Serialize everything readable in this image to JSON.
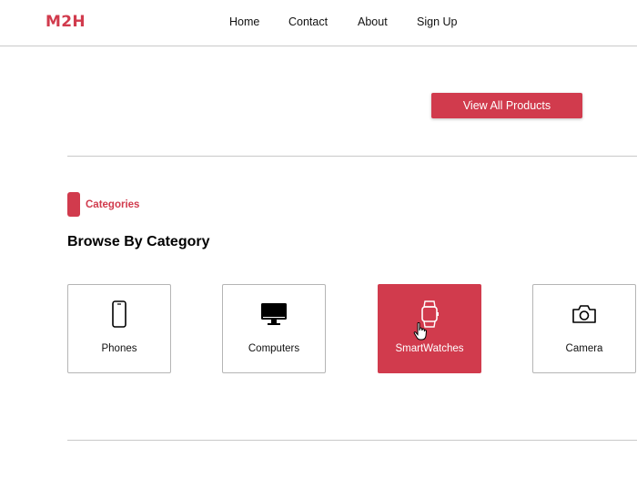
{
  "brand": {
    "logo": "M2H",
    "accent": "#d13b4d"
  },
  "nav": {
    "items": [
      "Home",
      "Contact",
      "About",
      "Sign Up"
    ]
  },
  "hero": {
    "view_all_label": "View All Products"
  },
  "categories": {
    "tag": "Categories",
    "title": "Browse By Category",
    "items": [
      {
        "label": "Phones",
        "icon": "phone-icon",
        "selected": false
      },
      {
        "label": "Computers",
        "icon": "monitor-icon",
        "selected": false
      },
      {
        "label": "SmartWatches",
        "icon": "smartwatch-icon",
        "selected": true
      },
      {
        "label": "Camera",
        "icon": "camera-icon",
        "selected": false
      }
    ]
  }
}
